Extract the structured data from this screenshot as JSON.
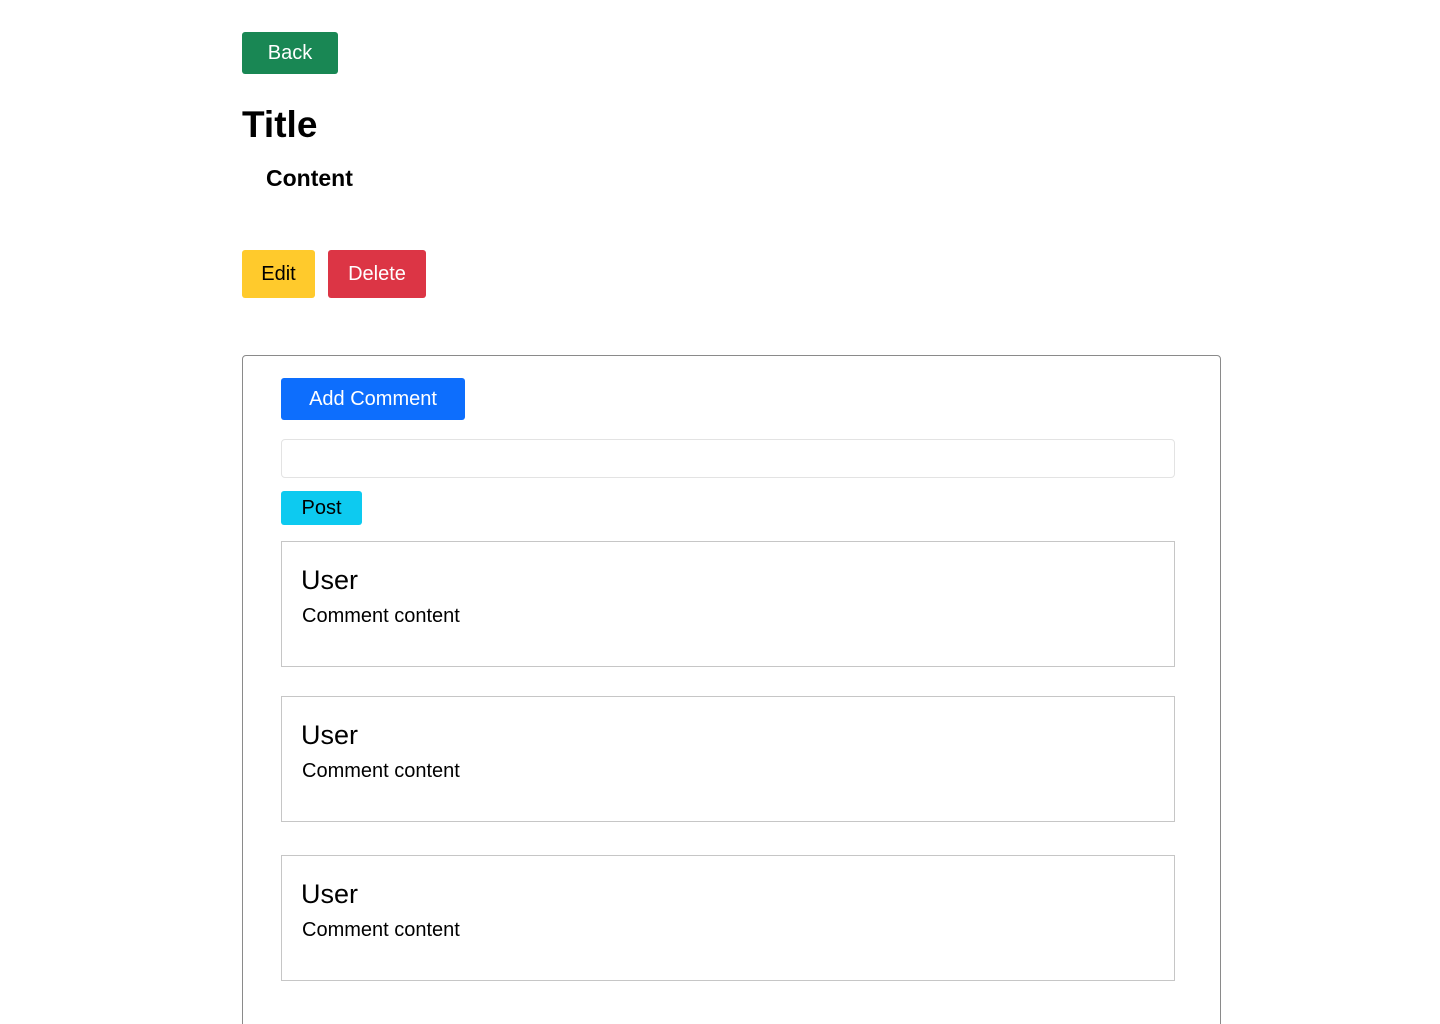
{
  "nav": {
    "back_label": "Back"
  },
  "post": {
    "title": "Title",
    "content": "Content",
    "edit_label": "Edit",
    "delete_label": "Delete"
  },
  "comments": {
    "add_label": "Add Comment",
    "input_value": "",
    "post_label": "Post",
    "items": [
      {
        "user": "User",
        "text": "Comment content"
      },
      {
        "user": "User",
        "text": "Comment content"
      },
      {
        "user": "User",
        "text": "Comment content"
      }
    ]
  },
  "colors": {
    "back": "#198754",
    "edit": "#ffca2c",
    "delete": "#dc3545",
    "add_comment": "#0d6efd",
    "post": "#0dcaf0"
  }
}
